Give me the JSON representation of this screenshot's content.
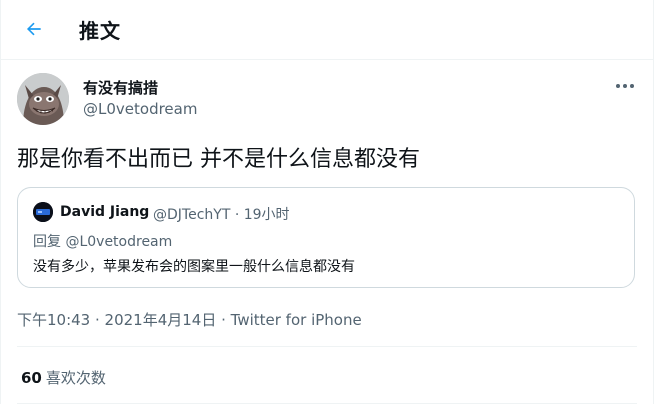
{
  "header": {
    "title": "推文",
    "back_icon": "arrow-left-icon"
  },
  "tweet": {
    "author": {
      "display_name": "有没有搞措",
      "handle": "@L0vetodream",
      "avatar": "avatar-icon"
    },
    "text": "那是你看不出而已 并不是什么信息都没有",
    "timestamp": "下午10:43 · 2021年4月14日 · Twitter for iPhone"
  },
  "quote": {
    "display_name": "David Jiang",
    "meta": "@DJTechYT · 19小时",
    "reply_prefix": "回复 ",
    "reply_handle": "@L0vetodream",
    "text": "没有多少，苹果发布会的图案里一般什么信息都没有"
  },
  "stats": {
    "likes_count": "60",
    "likes_label": "喜欢次数"
  },
  "colors": {
    "accent": "#1d9bf0",
    "text_primary": "#0f1419",
    "text_secondary": "#536471",
    "border": "#cfd9de",
    "divider": "#eff3f4"
  }
}
